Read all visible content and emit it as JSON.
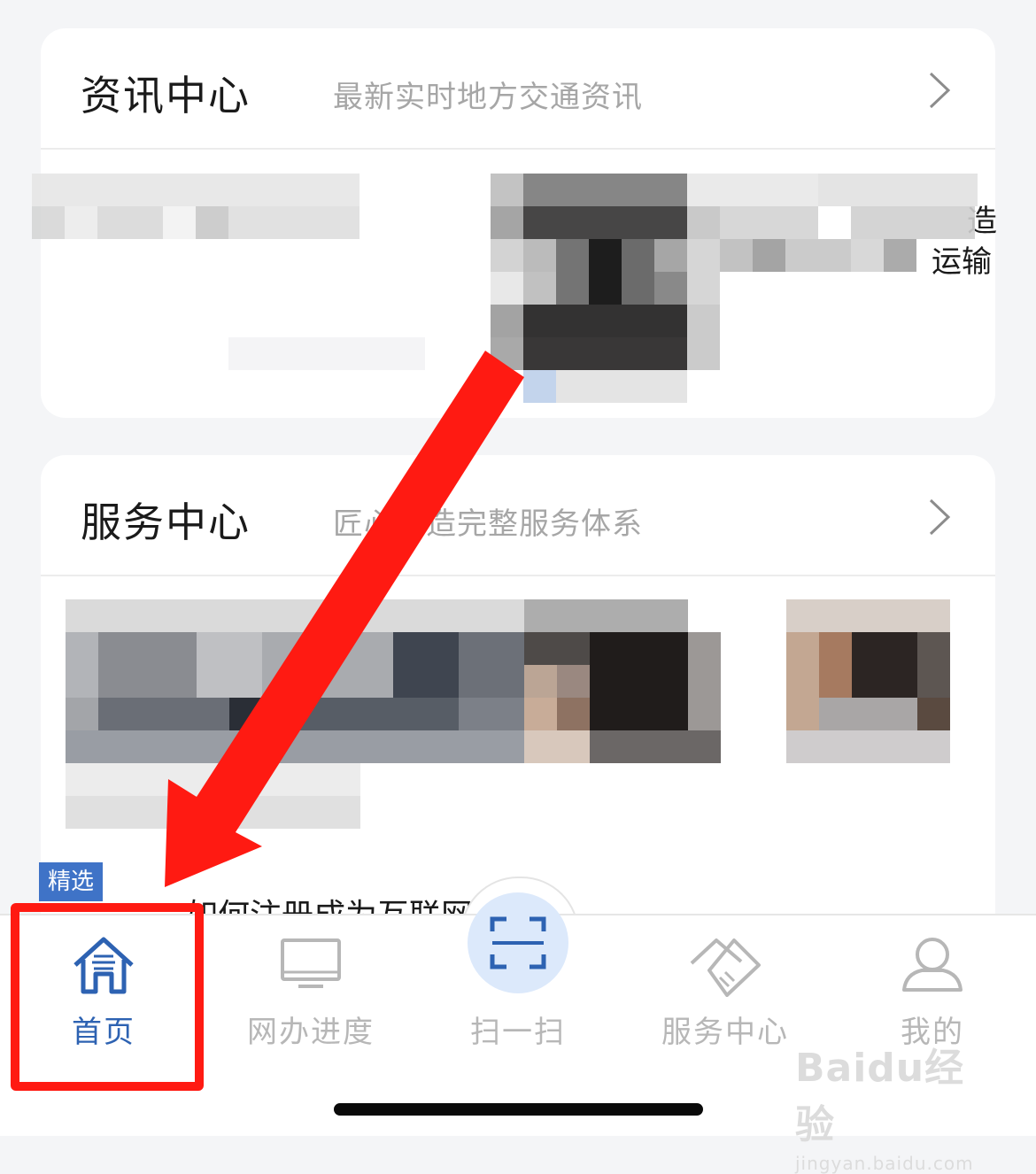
{
  "news_card": {
    "title": "资讯中心",
    "subtitle": "最新实时地方交通资讯",
    "partial_text_1": "造",
    "partial_text_2": "运输"
  },
  "service_card": {
    "title": "服务中心",
    "subtitle": "匠心打造完整服务体系",
    "tag": "精选",
    "article_title": "如何注册成为互联网用户?"
  },
  "tabs": [
    {
      "label": "首页",
      "icon": "home-icon",
      "active": true
    },
    {
      "label": "网办进度",
      "icon": "monitor-icon",
      "active": false
    },
    {
      "label": "扫一扫",
      "icon": "scan-icon",
      "active": false
    },
    {
      "label": "服务中心",
      "icon": "handshake-icon",
      "active": false
    },
    {
      "label": "我的",
      "icon": "user-icon",
      "active": false
    }
  ],
  "watermark": {
    "logo": "Baidu经验",
    "url": "jingyan.baidu.com"
  },
  "colors": {
    "accent": "#2d62b2",
    "annotation_red": "#ff1a12",
    "scan_bg": "#dce9fb"
  }
}
